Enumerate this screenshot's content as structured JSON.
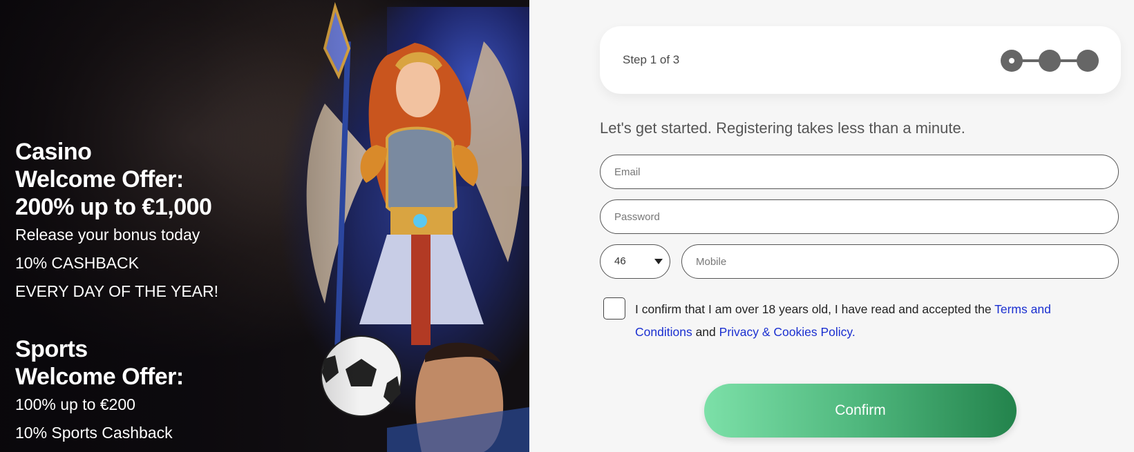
{
  "promo": {
    "casino": {
      "title_lines": [
        "Casino",
        "Welcome Offer:",
        "200% up to €1,000"
      ],
      "lines": [
        "Release your bonus today",
        "10% CASHBACK",
        "EVERY DAY OF THE YEAR!"
      ]
    },
    "sports": {
      "title_lines": [
        "Sports",
        "Welcome Offer:"
      ],
      "lines": [
        "100% up to €200",
        "10% Sports Cashback"
      ]
    }
  },
  "form": {
    "step_label": "Step 1 of 3",
    "step_current": 1,
    "step_total": 3,
    "intro": "Let's get started. Registering takes less than a minute.",
    "email_placeholder": "Email",
    "password_placeholder": "Password",
    "country_code": "46",
    "mobile_placeholder": "Mobile",
    "consent_prefix": "I confirm that I am over 18 years old, I have read and accepted the ",
    "terms_link": "Terms and Conditions",
    "consent_and": " and ",
    "privacy_link": "Privacy & Cookies Policy.",
    "confirm_label": "Confirm"
  },
  "colors": {
    "link": "#1a2fd0",
    "stepper": "#666666",
    "confirm_start": "#7ce0a8",
    "confirm_end": "#23834c"
  }
}
